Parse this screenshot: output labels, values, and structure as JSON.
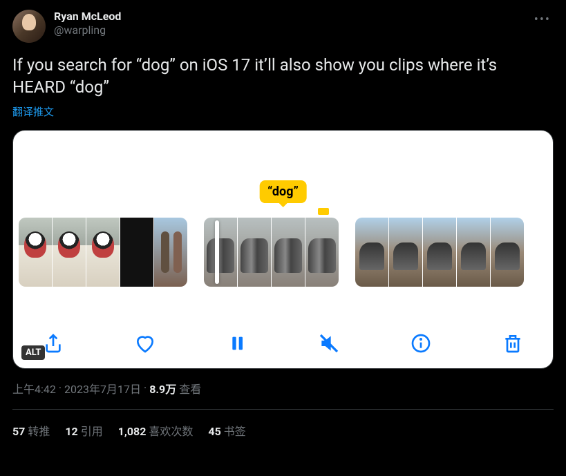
{
  "author": {
    "display_name": "Ryan McLeod",
    "handle": "@warpling"
  },
  "tweet_text": "If you search for “dog” on iOS 17 it’ll also show you clips where it’s HEARD “dog”",
  "translate_label": "翻译推文",
  "media": {
    "tooltip_text": "“dog”",
    "alt_badge": "ALT",
    "toolbar_icons": {
      "share": "share-icon",
      "like": "heart-icon",
      "pause": "pause-icon",
      "mute": "mute-icon",
      "info": "info-icon",
      "delete": "trash-icon"
    }
  },
  "meta": {
    "time": "上午4:42",
    "dot1": "·",
    "date": "2023年7月17日",
    "dot2": "·",
    "views_count": "8.9万",
    "views_label": "查看"
  },
  "stats": {
    "retweets": {
      "count": "57",
      "label": "转推"
    },
    "quotes": {
      "count": "12",
      "label": "引用"
    },
    "likes": {
      "count": "1,082",
      "label": "喜欢次数"
    },
    "bookmarks": {
      "count": "45",
      "label": "书签"
    }
  }
}
